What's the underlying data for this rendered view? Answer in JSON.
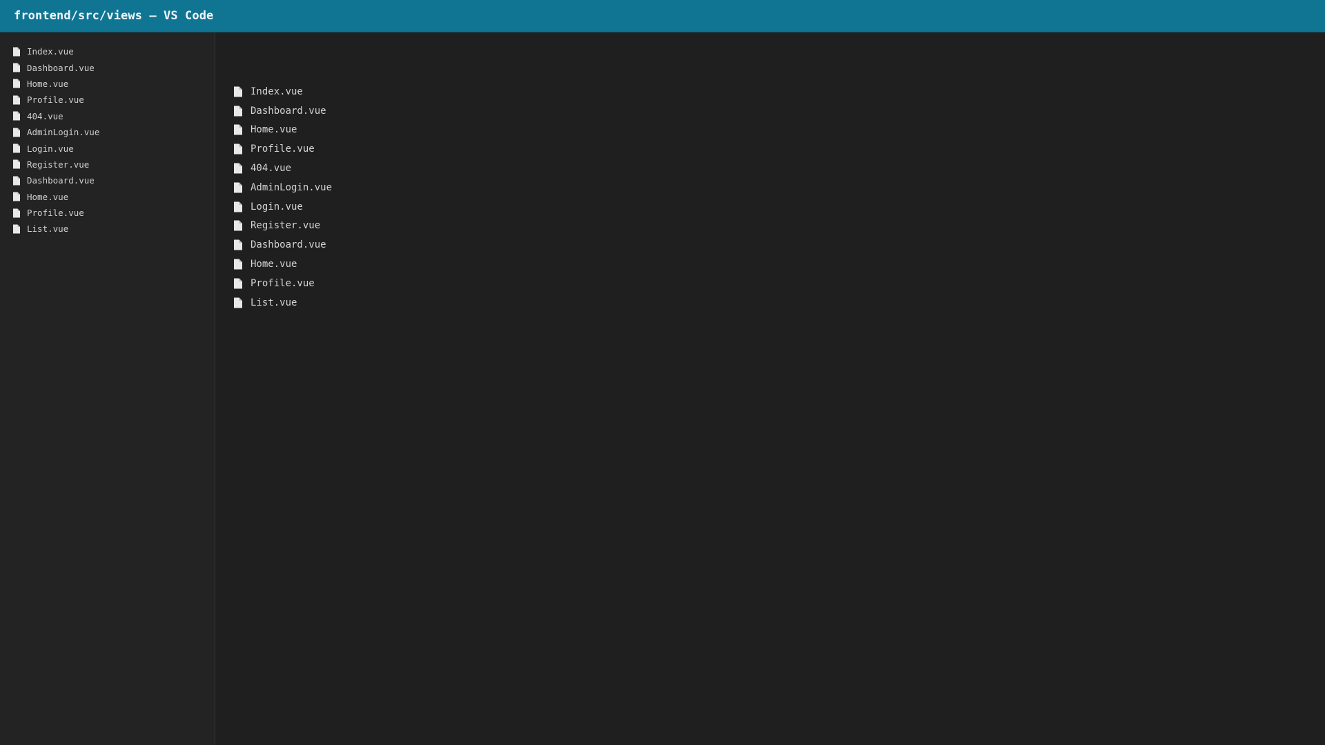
{
  "window": {
    "title": "frontend/src/views — VS Code"
  },
  "sidebar": {
    "items": [
      {
        "label": "Index.vue",
        "icon": "file-icon"
      },
      {
        "label": "Dashboard.vue",
        "icon": "file-icon"
      },
      {
        "label": "Home.vue",
        "icon": "file-icon"
      },
      {
        "label": "Profile.vue",
        "icon": "file-icon"
      },
      {
        "label": "404.vue",
        "icon": "file-icon"
      },
      {
        "label": "AdminLogin.vue",
        "icon": "file-icon"
      },
      {
        "label": "Login.vue",
        "icon": "file-icon"
      },
      {
        "label": "Register.vue",
        "icon": "file-icon"
      },
      {
        "label": "Dashboard.vue",
        "icon": "file-icon"
      },
      {
        "label": "Home.vue",
        "icon": "file-icon"
      },
      {
        "label": "Profile.vue",
        "icon": "file-icon"
      },
      {
        "label": "List.vue",
        "icon": "file-icon"
      }
    ]
  },
  "main": {
    "items": [
      {
        "label": "Index.vue",
        "icon": "file-icon"
      },
      {
        "label": "Dashboard.vue",
        "icon": "file-icon"
      },
      {
        "label": "Home.vue",
        "icon": "file-icon"
      },
      {
        "label": "Profile.vue",
        "icon": "file-icon"
      },
      {
        "label": "404.vue",
        "icon": "file-icon"
      },
      {
        "label": "AdminLogin.vue",
        "icon": "file-icon"
      },
      {
        "label": "Login.vue",
        "icon": "file-icon"
      },
      {
        "label": "Register.vue",
        "icon": "file-icon"
      },
      {
        "label": "Dashboard.vue",
        "icon": "file-icon"
      },
      {
        "label": "Home.vue",
        "icon": "file-icon"
      },
      {
        "label": "Profile.vue",
        "icon": "file-icon"
      },
      {
        "label": "List.vue",
        "icon": "file-icon"
      }
    ]
  },
  "colors": {
    "titlebar": "#0f7593",
    "sidebar_bg": "#232323",
    "editor_bg": "#1f1f1f",
    "text": "#d4d4d4"
  }
}
